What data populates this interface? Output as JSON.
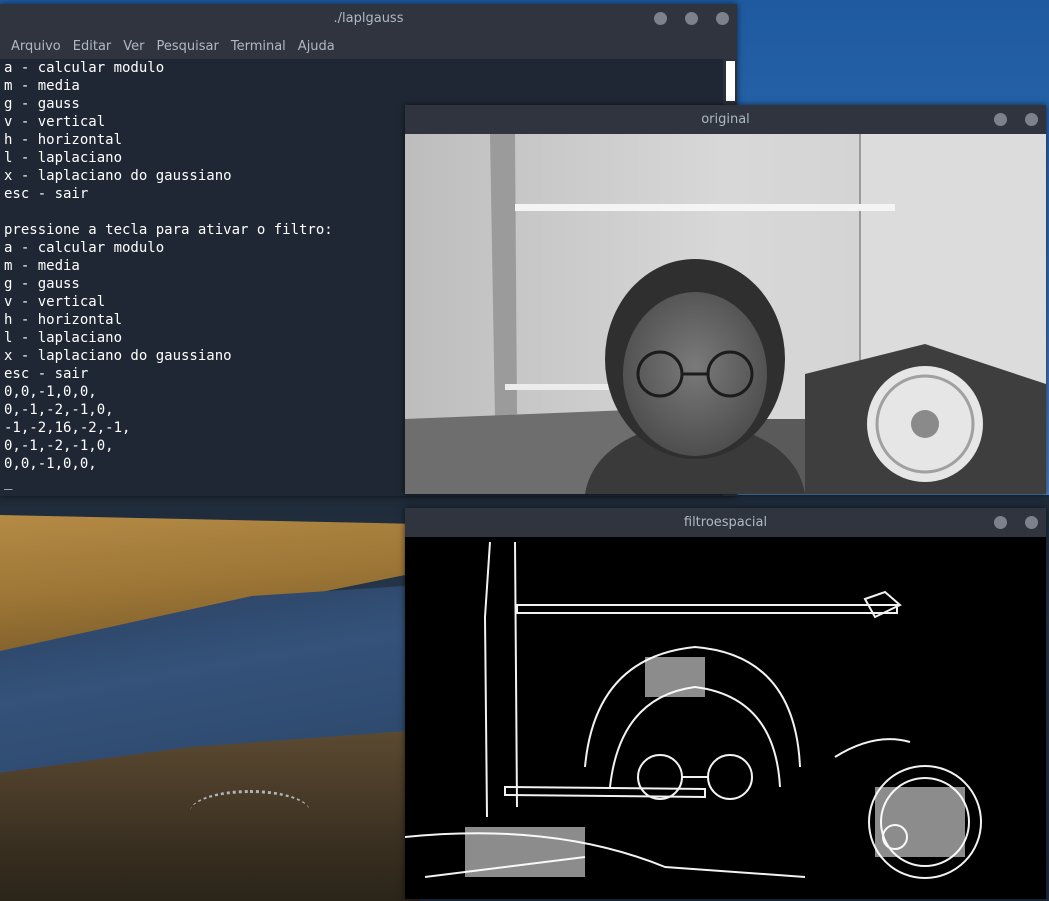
{
  "terminal": {
    "title": "./laplgauss",
    "menu": [
      "Arquivo",
      "Editar",
      "Ver",
      "Pesquisar",
      "Terminal",
      "Ajuda"
    ],
    "lines": [
      "a - calcular modulo",
      "m - media",
      "g - gauss",
      "v - vertical",
      "h - horizontal",
      "l - laplaciano",
      "x - laplaciano do gaussiano",
      "esc - sair",
      "",
      "pressione a tecla para ativar o filtro:",
      "a - calcular modulo",
      "m - media",
      "g - gauss",
      "v - vertical",
      "h - horizontal",
      "l - laplaciano",
      "x - laplaciano do gaussiano",
      "esc - sair",
      "0,0,-1,0,0,",
      "0,-1,-2,-1,0,",
      "-1,-2,16,-2,-1,",
      "0,-1,-2,-1,0,",
      "0,0,-1,0,0,"
    ],
    "cursor": "_"
  },
  "window_original": {
    "title": "original"
  },
  "window_filtro": {
    "title": "filtroespacial"
  },
  "colors": {
    "titlebar": "#2f343f",
    "terminal_bg": "#1e2733",
    "title_text": "#afb8c5",
    "window_button": "#7c818c"
  },
  "icons": {
    "minimize": "circle-minimize-icon",
    "close": "circle-close-icon"
  }
}
